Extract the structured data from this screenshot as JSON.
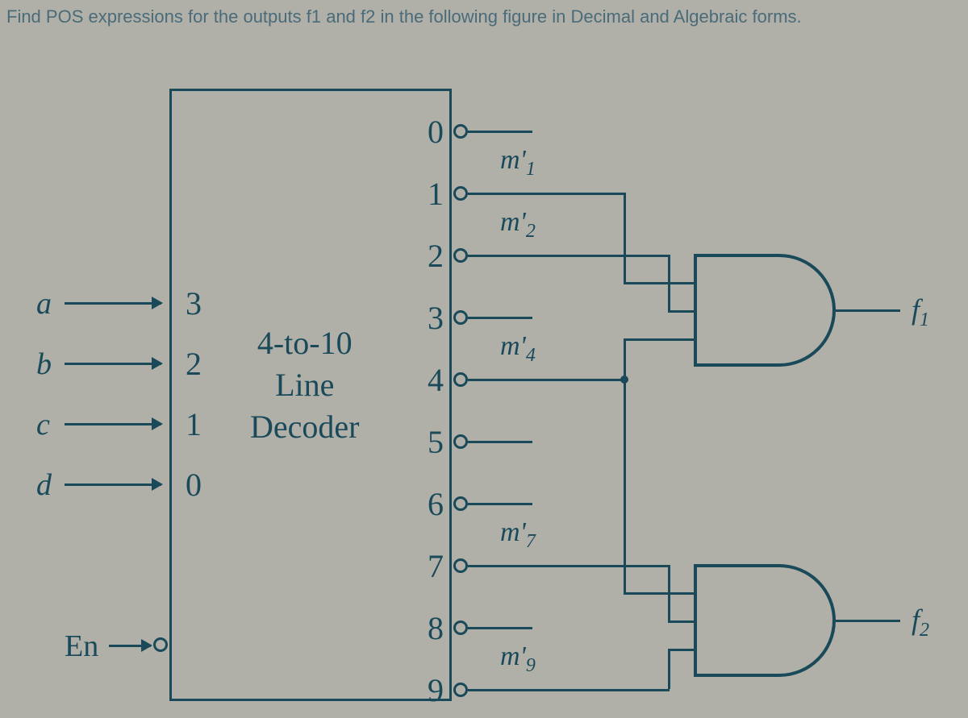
{
  "question": "Find POS expressions for the outputs f1 and f2 in the following figure in Decimal and Algebraic forms.",
  "inputs": {
    "a": {
      "label": "a",
      "weight": "3"
    },
    "b": {
      "label": "b",
      "weight": "2"
    },
    "c": {
      "label": "c",
      "weight": "1"
    },
    "d": {
      "label": "d",
      "weight": "0"
    },
    "en": {
      "label": "En"
    }
  },
  "decoder": {
    "line1": "4-to-10",
    "line2": "Line",
    "line3": "Decoder"
  },
  "outputs": [
    "0",
    "1",
    "2",
    "3",
    "4",
    "5",
    "6",
    "7",
    "8",
    "9"
  ],
  "maxterms": {
    "m1": "m'₁",
    "m2": "m'₂",
    "m4": "m'₄",
    "m7": "m'₇",
    "m9": "m'₉"
  },
  "functions": {
    "f1": "f₁",
    "f2": "f₂"
  }
}
